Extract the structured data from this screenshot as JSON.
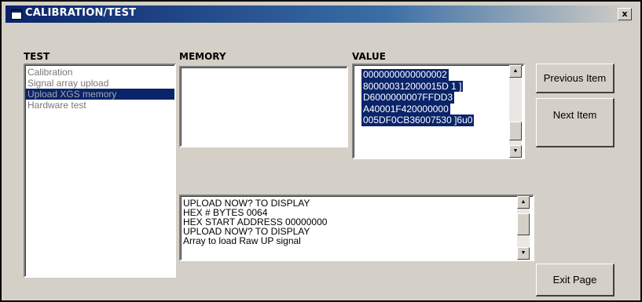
{
  "window": {
    "title": "CALIBRATION/TEST",
    "close_label": "x"
  },
  "test": {
    "label": "TEST",
    "items": [
      {
        "label": "Calibration",
        "selected": false
      },
      {
        "label": "Signal array upload",
        "selected": false
      },
      {
        "label": "Upload XGS memory",
        "selected": true
      },
      {
        "label": "Hardware test",
        "selected": false
      }
    ]
  },
  "memory": {
    "label": "MEMORY",
    "content": ""
  },
  "value": {
    "label": "VALUE",
    "lines": [
      "0000000000000002",
      "800000312000015D 1 ]",
      "D6000000007FFDD3",
      "A40001F420000000",
      "005DF0CB36007530 ]6u0"
    ]
  },
  "log": {
    "lines": [
      "UPLOAD NOW?  TO DISPLAY",
      "HEX # BYTES  0064",
      "HEX START ADDRESS  00000000",
      "UPLOAD NOW?  TO DISPLAY",
      "Array to load   Raw UP signal"
    ]
  },
  "buttons": {
    "previous_item": "Previous Item",
    "next_item": "Next Item",
    "exit_page": "Exit Page"
  },
  "icons": {
    "app": "window-app-icon",
    "close": "close-icon",
    "scroll_up": "scroll-up-arrow-icon",
    "scroll_down": "scroll-down-arrow-icon"
  },
  "colors": {
    "selection": "#0a246a",
    "titlebar_start": "#0a246a",
    "titlebar_end": "#d4d0c8",
    "face": "#d4d0c8"
  }
}
